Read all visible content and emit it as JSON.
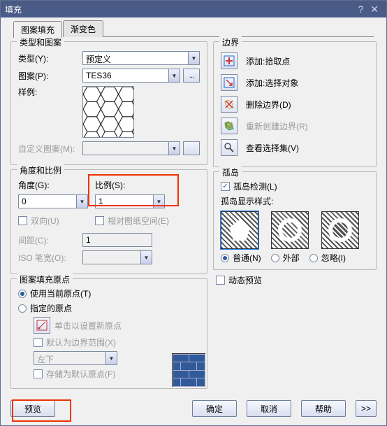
{
  "title": "填充",
  "tabs": {
    "pattern": "图案填充",
    "gradient": "渐变色"
  },
  "typeGroup": {
    "title": "类型和图案",
    "typeLabel": "类型(Y):",
    "typeValue": "预定义",
    "patternLabel": "图案(P):",
    "patternValue": "TES36",
    "sampleLabel": "样例:",
    "customLabel": "自定义图案(M):"
  },
  "angleGroup": {
    "title": "角度和比例",
    "angleLabel": "角度(G):",
    "angleValue": "0",
    "scaleLabel": "比例(S):",
    "scaleValue": "1",
    "bidirectional": "双向(U)",
    "relativePaper": "相对图纸空间(E)",
    "spacingLabel": "间距(C):",
    "spacingValue": "1",
    "isoLabel": "ISO 笔宽(O):"
  },
  "originGroup": {
    "title": "图案填充原点",
    "useCurrent": "使用当前原点(T)",
    "specified": "指定的原点",
    "clickSet": "单击以设置新原点",
    "defaultBoundary": "默认为边界范围(X)",
    "cornerValue": "左下",
    "saveDefault": "存储为默认原点(F)"
  },
  "boundaryGroup": {
    "title": "边界",
    "addPick": "添加:拾取点",
    "addSelect": "添加:选择对象",
    "removeBoundary": "删除边界(D)",
    "recreateBoundary": "重新创建边界(R)",
    "viewSelection": "查看选择集(V)"
  },
  "islandGroup": {
    "title": "孤岛",
    "detection": "孤岛检测(L)",
    "displayStyle": "孤岛显示样式:",
    "normal": "普通(N)",
    "outer": "外部",
    "ignore": "忽略(I)"
  },
  "dynamicPreview": "动态预览",
  "buttons": {
    "preview": "预览",
    "ok": "确定",
    "cancel": "取消",
    "help": "帮助",
    "expand": ">>"
  }
}
